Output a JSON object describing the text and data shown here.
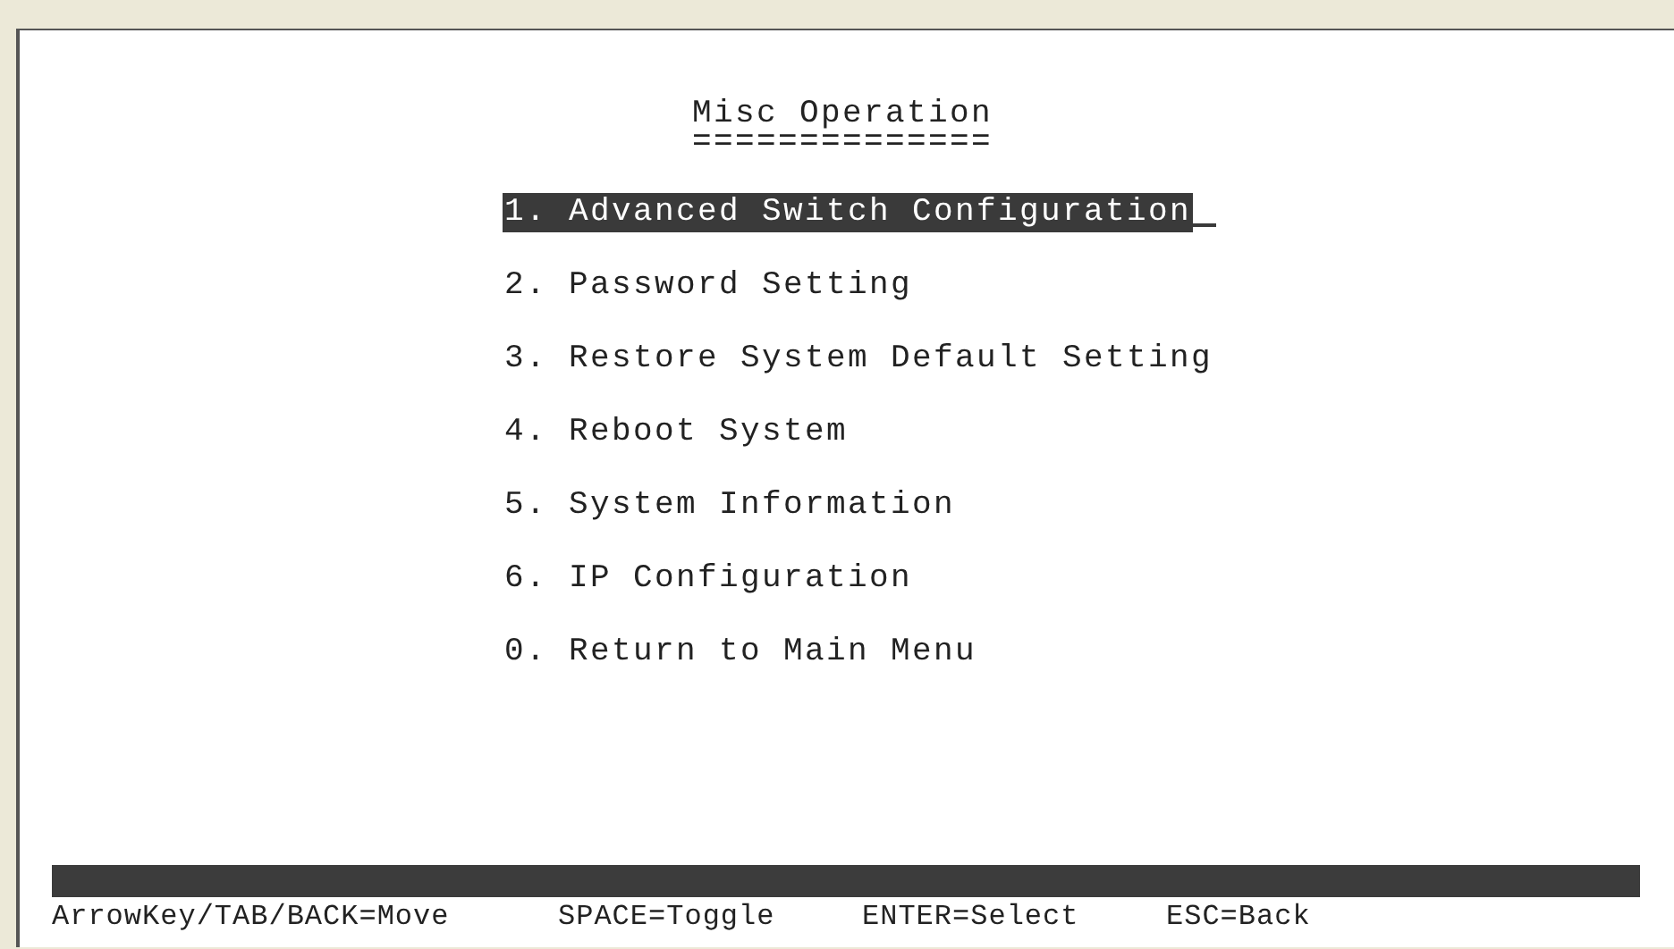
{
  "screen": {
    "title": "Misc Operation",
    "title_underline": "==============",
    "menu": [
      {
        "label": "1. Advanced Switch Configuration",
        "selected": true
      },
      {
        "label": "2. Password Setting",
        "selected": false
      },
      {
        "label": "3. Restore System Default Setting",
        "selected": false
      },
      {
        "label": "4. Reboot System",
        "selected": false
      },
      {
        "label": "5. System Information",
        "selected": false
      },
      {
        "label": "6. IP Configuration",
        "selected": false
      },
      {
        "label": "0. Return to Main Menu",
        "selected": false
      }
    ],
    "footer": [
      "ArrowKey/TAB/BACK=Move",
      "SPACE=Toggle",
      "ENTER=Select",
      "ESC=Back"
    ]
  }
}
